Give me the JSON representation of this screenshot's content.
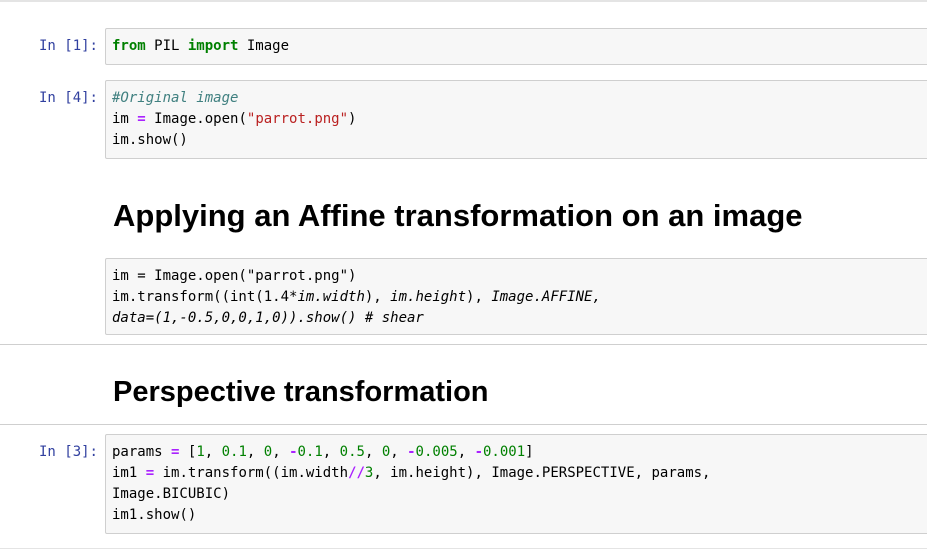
{
  "cells": [
    {
      "prompt": "In [1]:",
      "lines": [
        [
          {
            "t": "from",
            "c": "kw"
          },
          {
            "t": " PIL "
          },
          {
            "t": "import",
            "c": "kw"
          },
          {
            "t": " Image"
          }
        ]
      ]
    },
    {
      "prompt": "In [4]:",
      "lines": [
        [
          {
            "t": "#Original image",
            "c": "cm"
          }
        ],
        [
          {
            "t": "im "
          },
          {
            "t": "=",
            "c": "op"
          },
          {
            "t": " Image.open("
          },
          {
            "t": "\"parrot.png\"",
            "c": "st"
          },
          {
            "t": ")"
          }
        ],
        [
          {
            "t": "im.show()"
          }
        ]
      ]
    },
    {
      "heading": "Applying an Affine transformation on an image"
    },
    {
      "prompt": "",
      "lines": [
        [
          {
            "t": "im = Image.open(\"parrot.png\")"
          }
        ],
        [
          {
            "t": "im.transform((int(1.4"
          },
          {
            "t": "*im.width",
            "c": "it"
          },
          {
            "t": "), "
          },
          {
            "t": "im.height",
            "c": "it"
          },
          {
            "t": "), "
          },
          {
            "t": "Image.AFFINE,",
            "c": "it"
          }
        ],
        [
          {
            "t": "data=(1,-0.5,0,0,1,0)).show() # shear",
            "c": "it"
          }
        ]
      ]
    },
    {
      "heading": "Perspective transformation"
    },
    {
      "prompt": "In [3]:",
      "lines": [
        [
          {
            "t": "params "
          },
          {
            "t": "=",
            "c": "op"
          },
          {
            "t": " ["
          },
          {
            "t": "1",
            "c": "nm"
          },
          {
            "t": ", "
          },
          {
            "t": "0.1",
            "c": "nm"
          },
          {
            "t": ", "
          },
          {
            "t": "0",
            "c": "nm"
          },
          {
            "t": ", "
          },
          {
            "t": "-",
            "c": "op"
          },
          {
            "t": "0.1",
            "c": "nm"
          },
          {
            "t": ", "
          },
          {
            "t": "0.5",
            "c": "nm"
          },
          {
            "t": ", "
          },
          {
            "t": "0",
            "c": "nm"
          },
          {
            "t": ", "
          },
          {
            "t": "-",
            "c": "op"
          },
          {
            "t": "0.005",
            "c": "nm"
          },
          {
            "t": ", "
          },
          {
            "t": "-",
            "c": "op"
          },
          {
            "t": "0.001",
            "c": "nm"
          },
          {
            "t": "]"
          }
        ],
        [
          {
            "t": "im1 "
          },
          {
            "t": "=",
            "c": "op"
          },
          {
            "t": " im.transform((im.width"
          },
          {
            "t": "//",
            "c": "op"
          },
          {
            "t": "3",
            "c": "nm"
          },
          {
            "t": ", im.height), Image.PERSPECTIVE, params,"
          }
        ],
        [
          {
            "t": "Image.BICUBIC)"
          }
        ],
        [
          {
            "t": "im1.show()"
          }
        ]
      ]
    }
  ]
}
